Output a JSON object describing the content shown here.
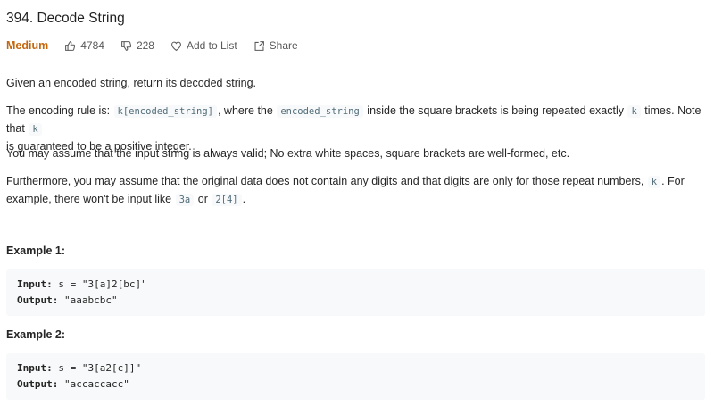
{
  "problem": {
    "title": "394. Decode String",
    "difficulty": "Medium",
    "likes": "4784",
    "dislikes": "228",
    "add_to_list": "Add to List",
    "share": "Share"
  },
  "description": {
    "p1": "Given an encoded string, return its decoded string.",
    "p2_a": "The encoding rule is: ",
    "p2_code1": "k[encoded_string]",
    "p2_b": ", where the ",
    "p2_code2": "encoded_string",
    "p2_c": " inside the square brackets is being repeated exactly ",
    "p2_code3": "k",
    "p2_d": " times. Note that ",
    "p2_code4": "k",
    "p2_e": "is guaranteed to be a positive integer.",
    "p3": "You may assume that the input string is always valid; No extra white spaces, square brackets are well-formed, etc.",
    "p4_a": "Furthermore, you may assume that the original data does not contain any digits and that digits are only for those repeat numbers, ",
    "p4_code1": "k",
    "p4_b": ". For",
    "p4_c": "example, there won't be input like ",
    "p4_code2": "3a",
    "p4_d": " or ",
    "p4_code3": "2[4]",
    "p4_e": "."
  },
  "examples": [
    {
      "title": "Example 1:",
      "input_label": "Input:",
      "input_value": "s = \"3[a]2[bc]\"",
      "output_label": "Output:",
      "output_value": "\"aaabcbc\""
    },
    {
      "title": "Example 2:",
      "input_label": "Input:",
      "input_value": "s = \"3[a2[c]]\"",
      "output_label": "Output:",
      "output_value": "\"accaccacc\""
    }
  ],
  "colors": {
    "difficulty": "#c4680f",
    "code_bg": "#f7f9fa"
  },
  "icons": [
    "thumbs-up-icon",
    "thumbs-down-icon",
    "heart-icon",
    "share-icon"
  ]
}
